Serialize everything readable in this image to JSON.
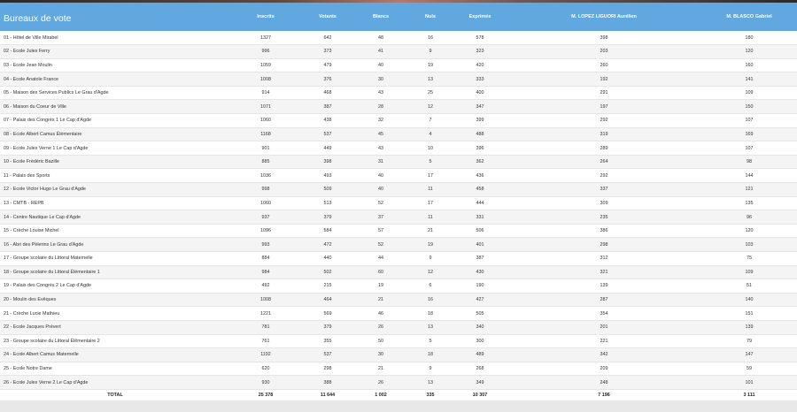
{
  "header": {
    "title": "Bureaux de vote",
    "columns": [
      "Inscrits",
      "Votants",
      "Blancs",
      "Nuls",
      "Exprimés",
      "M. LOPEZ LIGUORI Aurélien",
      "M. BLASCO Gabriel"
    ]
  },
  "rows": [
    {
      "name": "01 - Hôtel de Ville Mirabel",
      "values": [
        "1327",
        "642",
        "48",
        "16",
        "578",
        "398",
        "180"
      ]
    },
    {
      "name": "02 - Ecole Jules Ferry",
      "values": [
        "996",
        "373",
        "41",
        "9",
        "323",
        "203",
        "120"
      ]
    },
    {
      "name": "03 - Ecole Jean Moulin",
      "values": [
        "1059",
        "479",
        "40",
        "19",
        "420",
        "260",
        "160"
      ]
    },
    {
      "name": "04 - Ecole Anatole France",
      "values": [
        "1008",
        "376",
        "30",
        "13",
        "333",
        "192",
        "141"
      ]
    },
    {
      "name": "05 - Maison des Services Publics Le Grau d'Agde",
      "values": [
        "914",
        "468",
        "43",
        "25",
        "400",
        "291",
        "109"
      ]
    },
    {
      "name": "06 - Maison du Coeur de Ville",
      "values": [
        "1071",
        "387",
        "28",
        "12",
        "347",
        "197",
        "150"
      ]
    },
    {
      "name": "07 - Palais des Congrès 1 Le Cap d'Agde",
      "values": [
        "1060",
        "438",
        "32",
        "7",
        "399",
        "292",
        "107"
      ]
    },
    {
      "name": "08 - Ecole Albert Camus Élémentaire",
      "values": [
        "1168",
        "537",
        "45",
        "4",
        "488",
        "319",
        "169"
      ]
    },
    {
      "name": "09 - Ecole Jules Verne 1 Le Cap d'Agde",
      "values": [
        "901",
        "449",
        "43",
        "10",
        "396",
        "289",
        "107"
      ]
    },
    {
      "name": "10 - Ecole Frédéric Bazille",
      "values": [
        "885",
        "398",
        "31",
        "5",
        "362",
        "264",
        "98"
      ]
    },
    {
      "name": "11 - Palais des Sports",
      "values": [
        "1036",
        "493",
        "40",
        "17",
        "436",
        "292",
        "144"
      ]
    },
    {
      "name": "12 - Ecole Victor Hugo Le Grau d'Agde",
      "values": [
        "998",
        "509",
        "40",
        "11",
        "458",
        "337",
        "121"
      ]
    },
    {
      "name": "13 - CMTB - REPB",
      "values": [
        "1060",
        "513",
        "52",
        "17",
        "444",
        "309",
        "135"
      ]
    },
    {
      "name": "14 - Centre Nautique Le Cap d'Agde",
      "values": [
        "937",
        "379",
        "37",
        "11",
        "331",
        "235",
        "96"
      ]
    },
    {
      "name": "15 - Crèche Louise Michel",
      "values": [
        "1096",
        "584",
        "57",
        "21",
        "506",
        "386",
        "120"
      ]
    },
    {
      "name": "16 - Abri des Pèlerins Le Grau d'Agde",
      "values": [
        "993",
        "472",
        "52",
        "19",
        "401",
        "298",
        "103"
      ]
    },
    {
      "name": "17 - Groupe scolaire du Littoral Maternelle",
      "values": [
        "884",
        "440",
        "44",
        "9",
        "387",
        "312",
        "75"
      ]
    },
    {
      "name": "18 - Groupe scolaire du Littoral Élémentaire 1",
      "values": [
        "984",
        "502",
        "60",
        "12",
        "430",
        "321",
        "109"
      ]
    },
    {
      "name": "19 - Palais des Congrès 2 Le Cap d'Agde",
      "values": [
        "492",
        "215",
        "19",
        "6",
        "190",
        "139",
        "51"
      ]
    },
    {
      "name": "20 - Moulin des Evêques",
      "values": [
        "1008",
        "464",
        "21",
        "16",
        "427",
        "287",
        "140"
      ]
    },
    {
      "name": "21 - Crèche Lucie Mathieu",
      "values": [
        "1221",
        "569",
        "46",
        "18",
        "505",
        "354",
        "151"
      ]
    },
    {
      "name": "22 - Ecole Jacques Prévert",
      "values": [
        "781",
        "379",
        "26",
        "13",
        "340",
        "201",
        "139"
      ]
    },
    {
      "name": "23 - Groupe scolaire du Littoral Élémentaire 2",
      "values": [
        "761",
        "355",
        "50",
        "5",
        "300",
        "221",
        "79"
      ]
    },
    {
      "name": "24 - Ecole Albert Camus Maternelle",
      "values": [
        "1192",
        "537",
        "30",
        "18",
        "489",
        "342",
        "147"
      ]
    },
    {
      "name": "25 - Ecole Notre Dame",
      "values": [
        "620",
        "298",
        "21",
        "9",
        "268",
        "209",
        "59"
      ]
    },
    {
      "name": "26 - Ecole Jules Verne 2 Le Cap d'Agde",
      "values": [
        "930",
        "388",
        "26",
        "13",
        "349",
        "248",
        "101"
      ]
    }
  ],
  "total": {
    "label": "TOTAL",
    "values": [
      "25 378",
      "11 644",
      "1 002",
      "335",
      "10 307",
      "7 196",
      "3 111"
    ]
  }
}
